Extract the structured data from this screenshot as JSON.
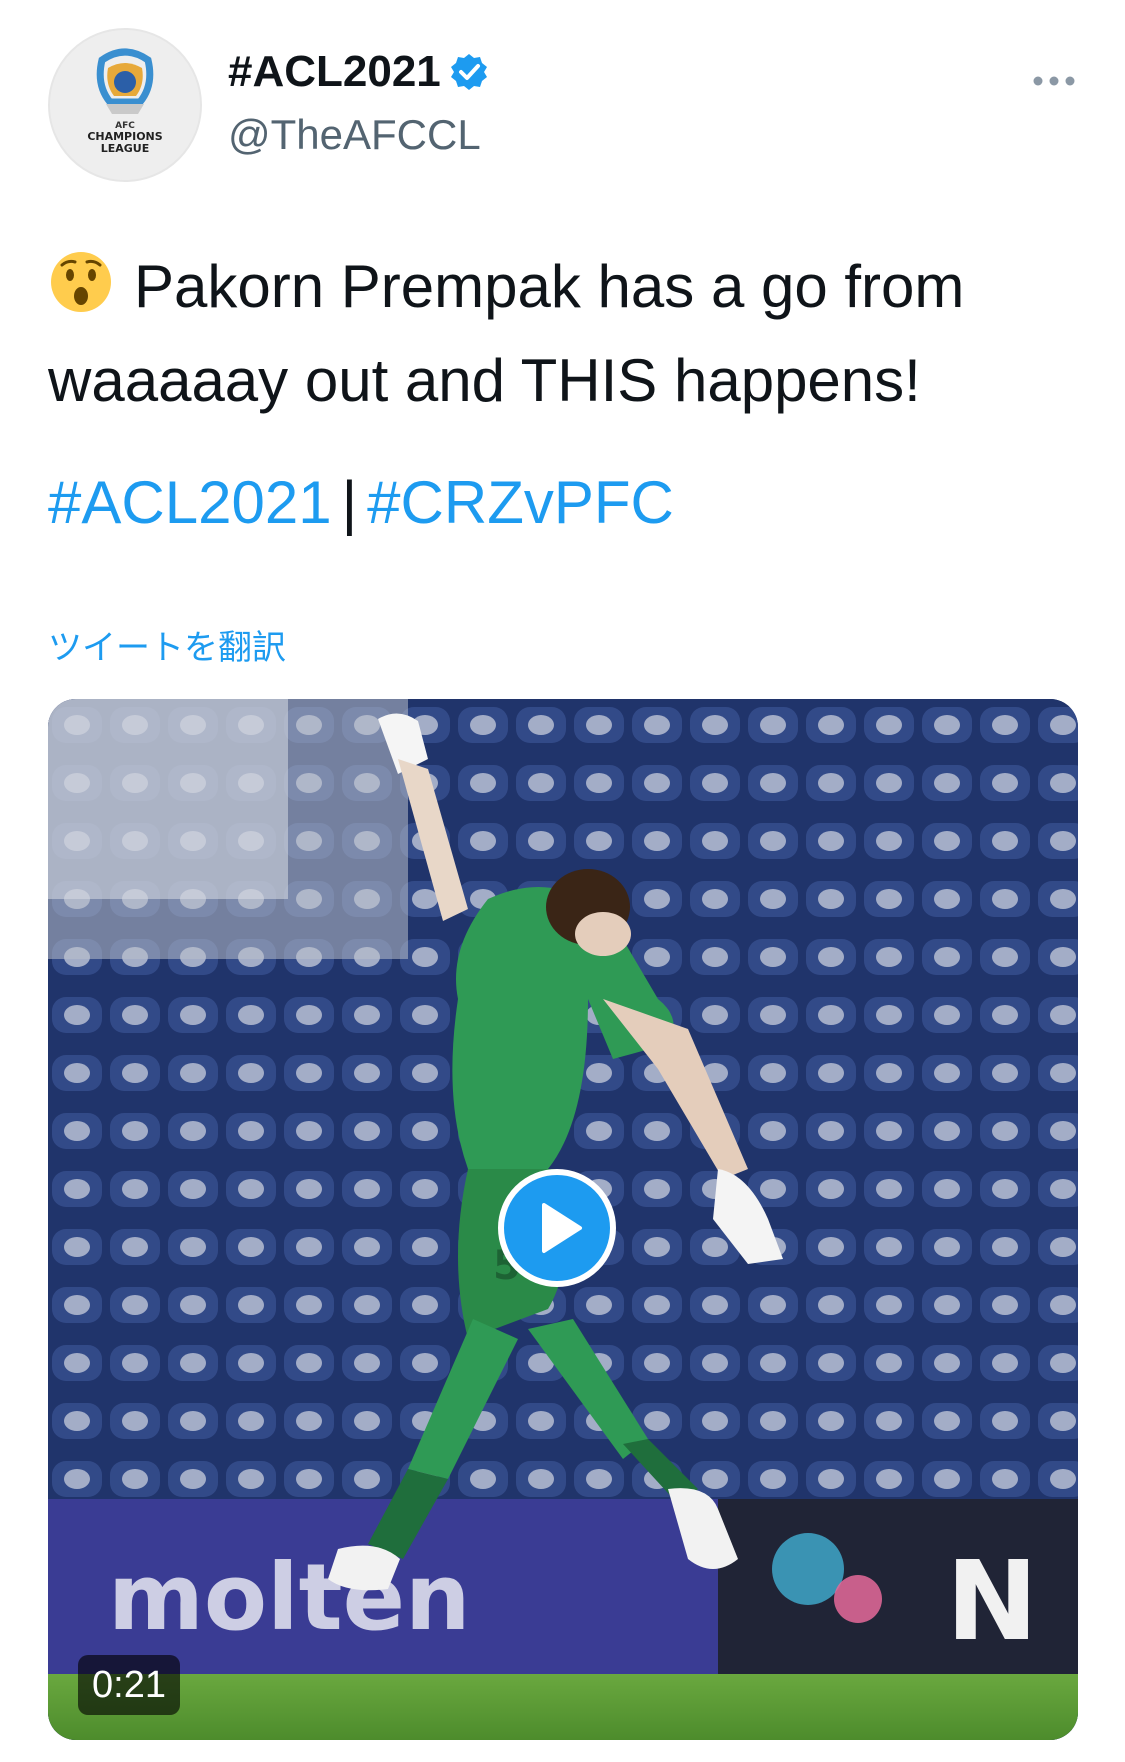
{
  "header": {
    "display_name": "#ACL2021",
    "handle": "@TheAFCCL",
    "avatar_text_line1": "AFC",
    "avatar_text_line2": "CHAMPIONS",
    "avatar_text_line3": "LEAGUE"
  },
  "tweet": {
    "emoji": "astonished-face-emoji",
    "line1": "Pakorn Prempak has a go from",
    "line2": "waaaaay out and THIS happens!",
    "hashtag1": "#ACL2021",
    "separator": "|",
    "hashtag2": "#CRZvPFC",
    "translate_label": "ツイートを翻訳"
  },
  "media": {
    "type": "video",
    "duration": "0:21",
    "board_text": "molten",
    "board_letter": "N",
    "shirt_number": "50"
  },
  "colors": {
    "link": "#1d9bf0",
    "text": "#0f1419",
    "secondary": "#536471",
    "verified": "#1d9bf0",
    "stadium_seats": "#2a3f7a",
    "jersey": "#2f9a55"
  }
}
